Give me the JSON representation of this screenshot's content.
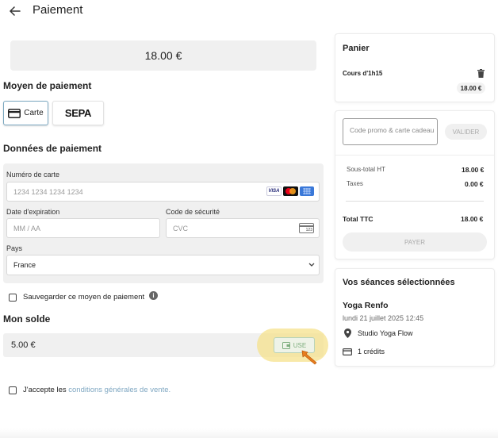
{
  "header": {
    "title": "Paiement"
  },
  "amount": {
    "value": "18.00 €"
  },
  "payment_method": {
    "title": "Moyen de paiement",
    "card_label": "Carte",
    "sepa_label": "SEPA"
  },
  "payment_data": {
    "title": "Données de paiement",
    "card_number_label": "Numéro de carte",
    "card_number_placeholder": "1234 1234 1234 1234",
    "card_brands": [
      "VISA",
      "mastercard",
      "amex"
    ],
    "expiry_label": "Date d'expiration",
    "expiry_placeholder": "MM / AA",
    "cvc_label": "Code de sécurité",
    "cvc_placeholder": "CVC",
    "cvc_badge": "123",
    "country_label": "Pays",
    "country_value": "France"
  },
  "save_method": {
    "label": "Sauvegarder ce moyen de paiement",
    "checked": false
  },
  "balance": {
    "title": "Mon solde",
    "value": "5.00 €",
    "use_label": "USE"
  },
  "terms": {
    "prefix": "J'accepte les ",
    "link": "conditions générales de vente.",
    "checked": false
  },
  "cart": {
    "title": "Panier",
    "item_name": "Cours d'1h15",
    "item_price": "18.00 €"
  },
  "promo": {
    "placeholder": "Code promo & carte cadeau",
    "apply_label": "VALIDER",
    "subtotal_label": "Sous-total HT",
    "subtotal_value": "18.00 €",
    "taxes_label": "Taxes",
    "taxes_value": "0.00 €",
    "total_label": "Total TTC",
    "total_value": "18.00 €",
    "pay_label": "PAYER"
  },
  "sessions": {
    "title": "Vos séances sélectionnées",
    "class_name": "Yoga Renfo",
    "datetime": "lundi 21 juillet 2025 12:45",
    "location": "Studio Yoga Flow",
    "credits": "1 crédits"
  },
  "colors": {
    "accent_link": "#7fa7c2",
    "selected_border": "#7aa7c0",
    "highlight": "#f5e18c",
    "cursor": "#e87d1e"
  }
}
